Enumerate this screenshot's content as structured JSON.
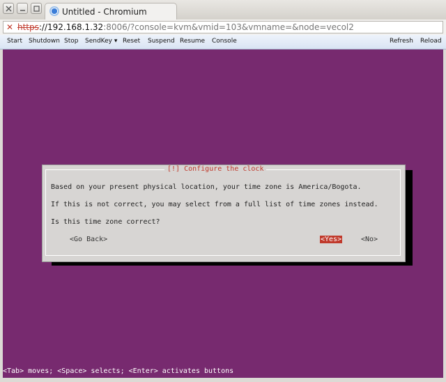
{
  "window": {
    "title": "Untitled - Chromium",
    "tab_title": "Untitled - Chromium"
  },
  "address": {
    "protocol": "https",
    "host": "://192.168.1.32",
    "rest": ":8006/?console=kvm&vmid=103&vmname=&node=vecol2"
  },
  "toolbar": {
    "items": [
      "Start",
      "Shutdown",
      "Stop",
      "SendKey",
      "Reset",
      "Suspend",
      "Resume",
      "Console"
    ],
    "right_items": [
      "Refresh",
      "Reload"
    ]
  },
  "dialog": {
    "title": "[!] Configure the clock",
    "lines": [
      "Based on your present physical location, your time zone is America/Bogota.",
      "If this is not correct, you may select from a full list of time zones instead.",
      "Is this time zone correct?"
    ],
    "buttons": {
      "back": "<Go Back>",
      "yes": "<Yes>",
      "no": "<No>"
    }
  },
  "status_line": "<Tab> moves; <Space> selects; <Enter> activates buttons"
}
